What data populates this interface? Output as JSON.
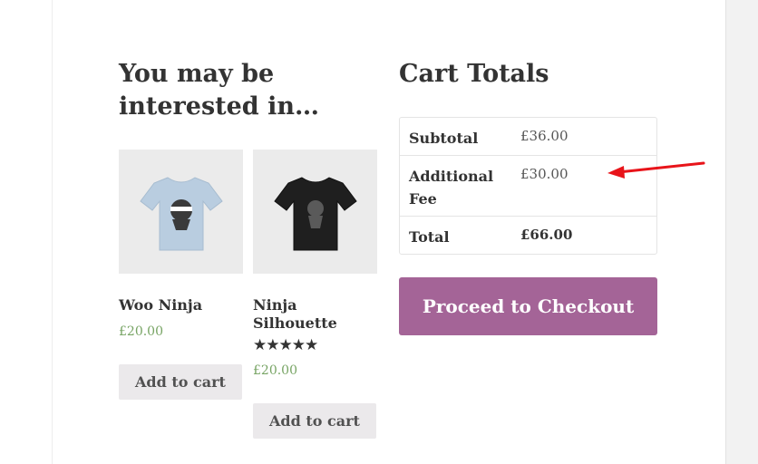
{
  "upsells": {
    "title": "You may be interested in…",
    "products": [
      {
        "name": "Woo Ninja",
        "price": "£20.00",
        "button": "Add to cart",
        "shirt_color": "#b9cde0",
        "rating": null
      },
      {
        "name": "Ninja Silhouette",
        "price": "£20.00",
        "button": "Add to cart",
        "shirt_color": "#1f1f1f",
        "rating": "★★★★★"
      }
    ]
  },
  "cart_totals": {
    "title": "Cart Totals",
    "rows": [
      {
        "label": "Subtotal",
        "value": "£36.00"
      },
      {
        "label": "Additional Fee",
        "value": "£30.00"
      },
      {
        "label": "Total",
        "value": "£66.00"
      }
    ],
    "checkout_button": "Proceed to Checkout"
  },
  "colors": {
    "price": "#77a464",
    "checkout": "#a46497",
    "annotation_arrow": "#e8141a"
  },
  "icons": {
    "rating": "star-icon",
    "annotation": "red-arrow-icon"
  }
}
